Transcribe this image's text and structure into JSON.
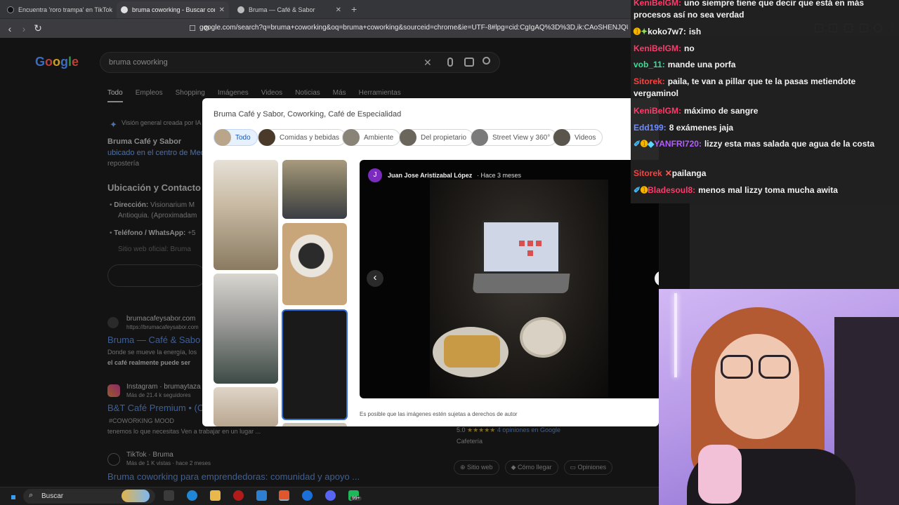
{
  "browser": {
    "tabs": [
      {
        "title": "Encuentra 'roro trampa' en TikTok | B"
      },
      {
        "title": "bruma coworking - Buscar con G"
      },
      {
        "title": "Bruma — Café & Sabor"
      }
    ],
    "url": "google.com/search?q=bruma+coworking&oq=bruma+coworking&sourceid=chrome&ie=UTF-8#lpg=cid:CgIgAQ%3D%3D,ik:CAoSHENJQUJ3aEN..."
  },
  "google": {
    "logo": "Google",
    "query": "bruma coworking",
    "tabs": [
      "Todo",
      "Empleos",
      "Shopping",
      "Imágenes",
      "Videos",
      "Noticias",
      "Más",
      "Herramientas"
    ],
    "ai_overview": "Visión general creada por IA",
    "snippet_title": "Bruma Café y Sabor",
    "snippet_line2": "ubicado en el centro de Med",
    "snippet_line3": "repostería",
    "contact_heading": "Ubicación y Contacto",
    "direccion_label": "Dirección:",
    "direccion_value": "Visionarium M",
    "direccion_line2": "Antioquia. (Aproximadam",
    "telefono_label": "Teléfono / WhatsApp:",
    "telefono_value": "+5",
    "sitio_label": "Sitio web oficial: Bruma",
    "results": [
      {
        "domain": "brumacafeysabor.com",
        "url": "https://brumacafeysabor.com",
        "title": "Bruma — Café & Sabo",
        "desc1": "Donde se mueve la energía, los",
        "desc2": "el café realmente puede ser"
      },
      {
        "domain": "Instagram · brumaytaza",
        "url": "Más de 21.4 k seguidores",
        "title": "B&T Café Premium • (C",
        "desc1": "#COWORKING MOOD",
        "desc2": "tenemos lo que necesitas Ven a trabajar en un lugar ..."
      },
      {
        "domain": "TikTok · Bruma",
        "url": "Más de 1 K vistas · hace 2 meses",
        "title": "Bruma coworking para emprendedoras: comunidad y apoyo ..."
      }
    ],
    "rating": "5.0",
    "rating_count": "4 opiniones en Google",
    "category": "Cafetería",
    "actions": [
      "Sitio web",
      "Cómo llegar",
      "Opiniones"
    ]
  },
  "modal": {
    "title": "Bruma Café y Sabor, Coworking, Café de Especialidad",
    "chips": [
      "Todo",
      "Comidas y bebidas",
      "Ambiente",
      "Del propietario",
      "Street View y 360°",
      "Videos"
    ],
    "author_initial": "J",
    "author": "Juan Jose Aristizabal López",
    "time": "Hace 3 meses",
    "copyright": "Es posible que las imágenes estén sujetas a derechos de autor"
  },
  "chat": [
    {
      "user": "KeniBelGM:",
      "text": "uno siempre tiene que decir que está en más procesos así no sea verdad",
      "color": "#ff3b6b"
    },
    {
      "user": "koko7w7:",
      "text": "ish",
      "color": "#ffffff"
    },
    {
      "user": "KeniBelGM:",
      "text": "no",
      "color": "#ff3b6b"
    },
    {
      "user": "vob_11:",
      "text": "mande una porfa",
      "color": "#3ddc97"
    },
    {
      "user": "Sitorek:",
      "text": "paila, te van a pillar que te la pasas metiendote vergaminol",
      "color": "#ff4040"
    },
    {
      "user": "KeniBelGM:",
      "text": "máximo de sangre",
      "color": "#ff3b6b"
    },
    {
      "user": "Edd199:",
      "text": "8 exámenes jaja",
      "color": "#6e8cff"
    },
    {
      "user": "YANFRI720:",
      "text": "lizzy esta mas salada que agua de la costa",
      "color": "#b45cff"
    },
    {
      "user": "Sitorek",
      "text": "pailanga",
      "color": "#ff4040"
    },
    {
      "user": "Bladesoul8:",
      "text": "menos mal lizzy toma mucha awita",
      "color": "#ff3b6b"
    }
  ],
  "taskbar": {
    "search": "Buscar",
    "badge": "99+"
  }
}
